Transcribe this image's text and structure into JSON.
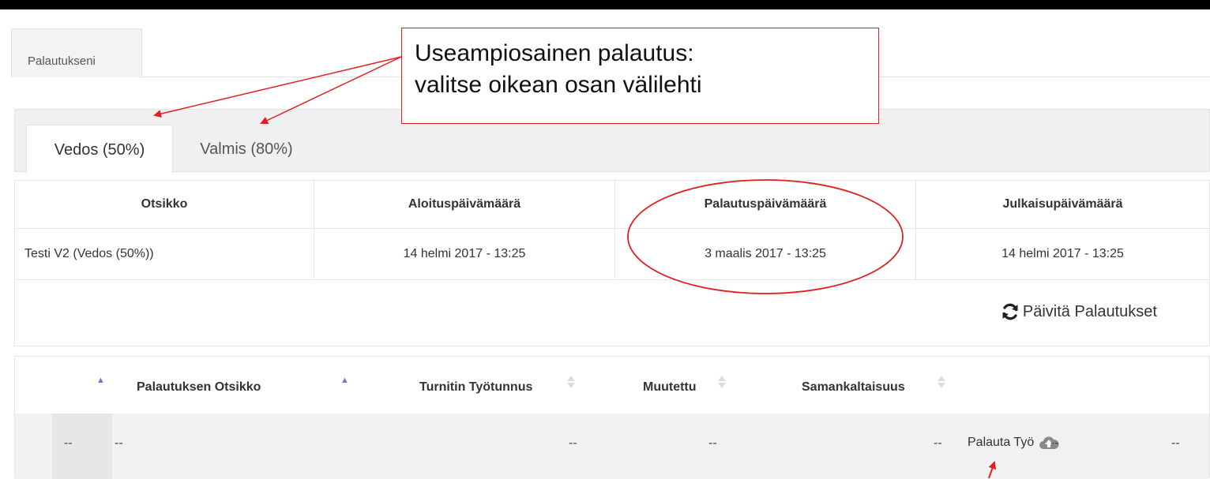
{
  "page_tab": {
    "label": "Palautukseni"
  },
  "part_tabs": [
    {
      "label": "Vedos (50%)",
      "active": true
    },
    {
      "label": "Valmis (80%)",
      "active": false
    }
  ],
  "info_table": {
    "headers": [
      "Otsikko",
      "Aloituspäivämäärä",
      "Palautuspäivämäärä",
      "Julkaisupäivämäärä"
    ],
    "row": [
      "Testi V2 (Vedos (50%))",
      "14 helmi 2017 - 13:25",
      "3 maalis 2017 - 13:25",
      "14 helmi 2017 - 13:25"
    ]
  },
  "refresh": {
    "label": "Päivitä Palautukset",
    "icon": "refresh-icon"
  },
  "submissions": {
    "headers": [
      "Palautuksen Otsikko",
      "Turnitin Työtunnus",
      "Muutettu",
      "Samankaltaisuus"
    ],
    "row": {
      "c1": "--",
      "c2": "--",
      "c3": "--",
      "c4": "--",
      "c5": "--",
      "submit_label": "Palauta Työ",
      "c6": "--",
      "c7": "--"
    }
  },
  "annotation": {
    "line1": "Useampiosainen palautus:",
    "line2": "valitse oikean osan välilehti",
    "color": "#e02020"
  }
}
